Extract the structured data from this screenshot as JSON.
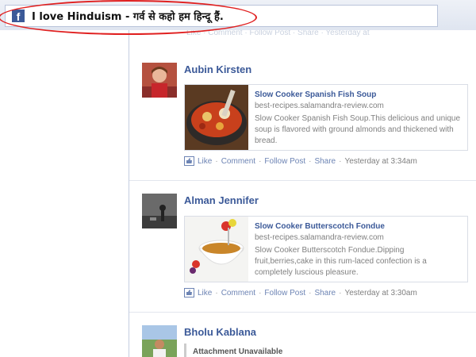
{
  "banner": {
    "title": "I love Hinduism - गर्व से कहो हम हिन्दू हैं."
  },
  "ghost_actions": "Like · Comment · Follow Post · Share · Yesterday at",
  "posts": [
    {
      "author": "Aubin Kirsten",
      "attachment": {
        "title": "Slow Cooker Spanish Fish Soup",
        "domain": "best-recipes.salamandra-review.com",
        "description": "Slow Cooker Spanish Fish Soup.This delicious and unique soup is flavored with ground almonds and thickened with bread."
      },
      "actions": {
        "like": "Like",
        "comment": "Comment",
        "follow": "Follow Post",
        "share": "Share",
        "time": "Yesterday at 3:34am"
      }
    },
    {
      "author": "Alman Jennifer",
      "attachment": {
        "title": "Slow Cooker Butterscotch Fondue",
        "domain": "best-recipes.salamandra-review.com",
        "description": "Slow Cooker Butterscotch Fondue.Dipping fruit,berries,cake in this rum-laced confection is a completely luscious pleasure."
      },
      "actions": {
        "like": "Like",
        "comment": "Comment",
        "follow": "Follow Post",
        "share": "Share",
        "time": "Yesterday at 3:30am"
      }
    },
    {
      "author": "Bholu Kablana",
      "attachment_unavailable": "Attachment Unavailable"
    }
  ],
  "colors": {
    "link": "#3b5998",
    "action_link": "#6d84b4",
    "annotation": "#e02020"
  }
}
